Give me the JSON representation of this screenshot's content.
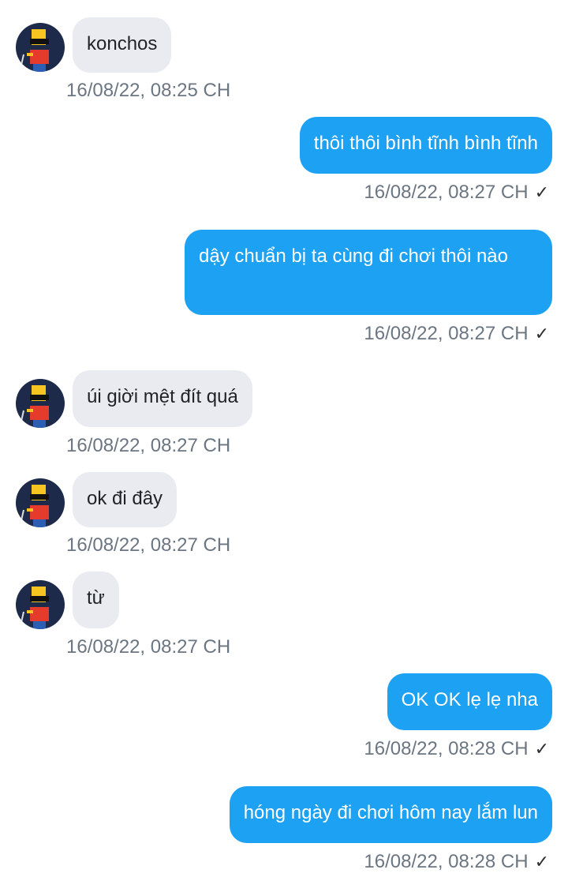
{
  "messages": [
    {
      "dir": "in",
      "text": "konchos",
      "time": "16/08/22,  08:25 CH"
    },
    {
      "dir": "out",
      "text": "thôi thôi bình tĩnh bình tĩnh",
      "time": "16/08/22,  08:27 CH"
    },
    {
      "dir": "out",
      "text": "dậy chuẩn bị ta cùng đi chơi thôi nào",
      "time": "16/08/22,  08:27 CH"
    },
    {
      "dir": "in",
      "text": "úi giời mệt đít quá",
      "time": "16/08/22,  08:27 CH"
    },
    {
      "dir": "in",
      "text": "ok đi đây",
      "time": "16/08/22,  08:27 CH"
    },
    {
      "dir": "in",
      "text": "từ",
      "time": "16/08/22,  08:27 CH"
    },
    {
      "dir": "out",
      "text": "OK OK lẹ lẹ nha",
      "time": "16/08/22,  08:28 CH"
    },
    {
      "dir": "out",
      "text": "hóng ngày đi chơi hôm nay lắm lun",
      "time": "16/08/22,  08:28 CH"
    }
  ],
  "icons": {
    "read_receipt": "check-icon",
    "avatar": "avatar-icon"
  },
  "colors": {
    "outgoing_bubble": "#1da1f2",
    "incoming_bubble": "#e9ebf0",
    "timestamp": "#6b7682"
  }
}
